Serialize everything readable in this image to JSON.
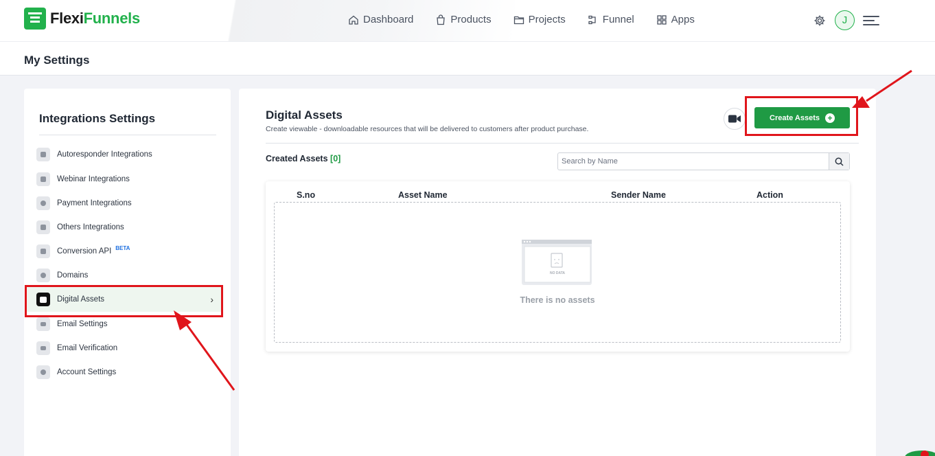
{
  "brand": {
    "part1": "Flexi",
    "part2": "Funnels"
  },
  "nav": {
    "items": [
      {
        "label": "Dashboard",
        "icon": "home-icon"
      },
      {
        "label": "Products",
        "icon": "bag-icon"
      },
      {
        "label": "Projects",
        "icon": "folder-icon"
      },
      {
        "label": "Funnel",
        "icon": "funnel-icon"
      },
      {
        "label": "Apps",
        "icon": "apps-grid-icon"
      }
    ],
    "avatar_initial": "J"
  },
  "page": {
    "title": "My Settings"
  },
  "sidebar": {
    "title": "Integrations Settings",
    "items": [
      {
        "label": "Autoresponder Integrations",
        "icon": "user-icon"
      },
      {
        "label": "Webinar Integrations",
        "icon": "play-icon"
      },
      {
        "label": "Payment Integrations",
        "icon": "dollar-icon"
      },
      {
        "label": "Others Integrations",
        "icon": "document-icon"
      },
      {
        "label": "Conversion API",
        "icon": "document-icon",
        "badge": "BETA"
      },
      {
        "label": "Domains",
        "icon": "globe-icon"
      },
      {
        "label": "Digital Assets",
        "icon": "gift-icon",
        "active": true
      },
      {
        "label": "Email Settings",
        "icon": "mail-icon"
      },
      {
        "label": "Email Verification",
        "icon": "mail-check-icon"
      },
      {
        "label": "Account Settings",
        "icon": "gear-icon"
      }
    ]
  },
  "main": {
    "title": "Digital Assets",
    "description": "Create viewable - downloadable resources that will be delivered to customers after product purchase.",
    "create_button": "Create Assets",
    "created_label": "Created Assets",
    "created_count": "[0]",
    "search_placeholder": "Search by Name",
    "columns": [
      "S.no",
      "Asset Name",
      "Sender Name",
      "Action"
    ],
    "empty_image_label": "NO DATA",
    "empty_text": "There is no assets"
  },
  "colors": {
    "brand_green": "#22b14c",
    "button_green": "#1f9a44",
    "annotation_red": "#e0151b",
    "beta_blue": "#1d6fe0"
  }
}
